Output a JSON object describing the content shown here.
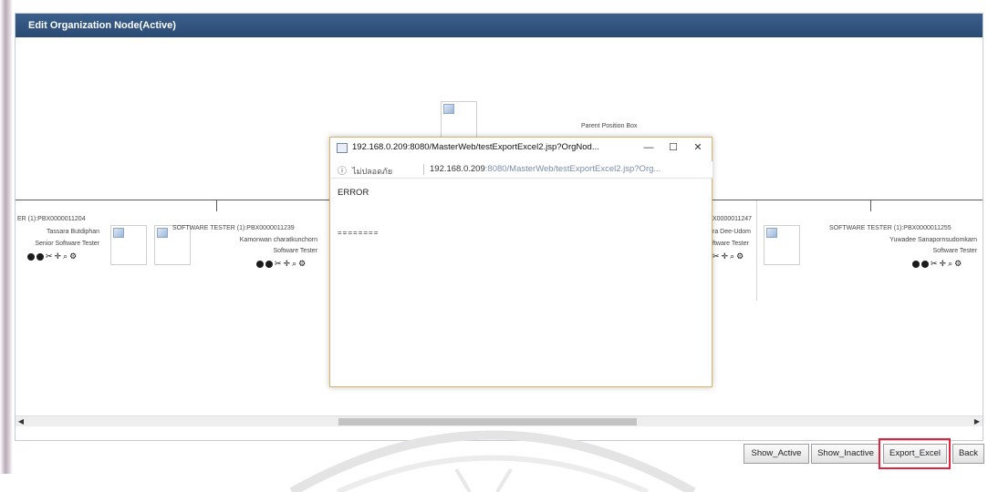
{
  "panel": {
    "title": "Edit Organization Node(Active)"
  },
  "org_chart": {
    "parent_label": "Parent Position Box",
    "positions": [
      {
        "title": "ER (1):PBX0000011204",
        "name": "Tassara Butdiphan",
        "role": "Senior Software Tester"
      },
      {
        "title": "SOFTWARE TESTER (1):PBX0000011239",
        "name": "Kamonwan charatkunchorn",
        "role": "Software Tester"
      },
      {
        "title": "X0000011247",
        "name": "ra Dee-Udom",
        "role": "ftware Tester"
      },
      {
        "title": "SOFTWARE TESTER (1):PBX0000011255",
        "name": "Yuwadee Sanapornsudomkarn",
        "role": "Software Tester"
      }
    ],
    "node_controls": [
      "add-icon",
      "remove-icon",
      "cut-icon",
      "move-icon",
      "search-icon",
      "settings-icon"
    ]
  },
  "popup": {
    "title": "192.168.0.209:8080/MasterWeb/testExportExcel2.jsp?OrgNod...",
    "minimize": "—",
    "maximize": "☐",
    "close": "✕",
    "info_symbol": "ⓘ",
    "not_secure": "ไม่ปลอดภัย",
    "url_main": "192.168.0.209",
    "url_rest": ":8080/MasterWeb/testExportExcel2.jsp?Org...",
    "error_text": "ERROR",
    "separator_text": "========"
  },
  "buttons": {
    "show_active": "Show_Active",
    "show_inactive": "Show_Inactive",
    "export_excel": "Export_Excel",
    "back": "Back"
  },
  "colors": {
    "header_bg": "#2f5480",
    "highlight": "#e0233f"
  }
}
